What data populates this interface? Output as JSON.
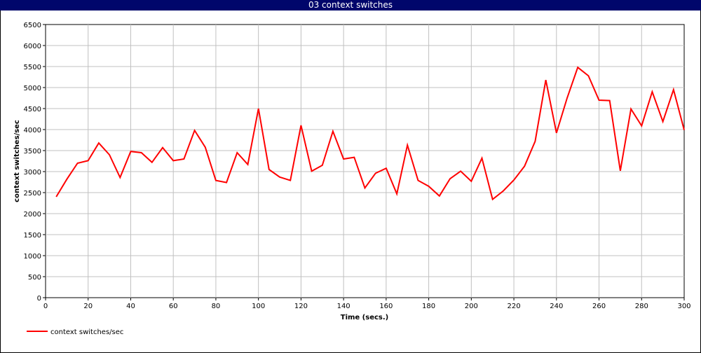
{
  "window": {
    "title": "03 context switches"
  },
  "chart_data": {
    "type": "line",
    "title": "03 context switches",
    "xlabel": "Time (secs.)",
    "ylabel": "context switches/sec",
    "xlim": [
      0,
      300
    ],
    "ylim": [
      0,
      6500
    ],
    "x_ticks": [
      0,
      20,
      40,
      60,
      80,
      100,
      120,
      140,
      160,
      180,
      200,
      220,
      240,
      260,
      280,
      300
    ],
    "y_ticks": [
      0,
      500,
      1000,
      1500,
      2000,
      2500,
      3000,
      3500,
      4000,
      4500,
      5000,
      5500,
      6000,
      6500
    ],
    "grid": true,
    "legend_position": "bottom-left",
    "series": [
      {
        "name": "context switches/sec",
        "color": "#ff0000",
        "x": [
          5,
          10,
          15,
          20,
          25,
          30,
          35,
          40,
          45,
          50,
          55,
          60,
          65,
          70,
          75,
          80,
          85,
          90,
          95,
          100,
          105,
          110,
          115,
          120,
          125,
          130,
          135,
          140,
          145,
          150,
          155,
          160,
          165,
          170,
          175,
          180,
          185,
          190,
          195,
          200,
          205,
          210,
          215,
          220,
          225,
          230,
          235,
          240,
          245,
          250,
          255,
          260,
          265,
          270,
          275,
          280,
          285,
          290,
          295,
          300
        ],
        "y": [
          2400,
          2820,
          3200,
          3260,
          3680,
          3400,
          2860,
          3480,
          3450,
          3220,
          3570,
          3260,
          3300,
          3980,
          3580,
          2790,
          2740,
          3450,
          3170,
          4500,
          3050,
          2870,
          2790,
          4100,
          3010,
          3150,
          3960,
          3300,
          3340,
          2610,
          2960,
          3080,
          2470,
          3630,
          2790,
          2650,
          2420,
          2830,
          3010,
          2770,
          3320,
          2340,
          2540,
          2800,
          3130,
          3720,
          5180,
          3920,
          4750,
          5480,
          5280,
          4700,
          4690,
          3020,
          4490,
          4090,
          4900,
          4190,
          4950,
          3990
        ]
      }
    ]
  }
}
